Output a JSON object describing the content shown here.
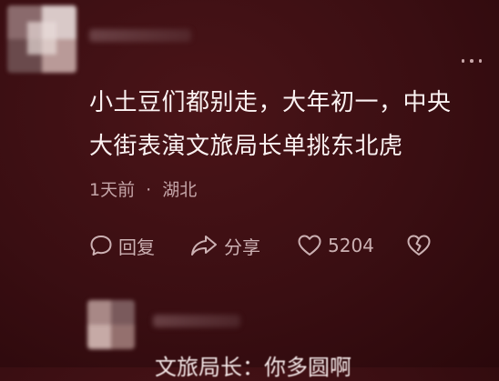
{
  "comment": {
    "line1": "小土豆们都别走，大年初一，中央",
    "line2": "大街表演文旅局长单挑东北虎",
    "time": "1天前",
    "separator": "·",
    "location": "湖北",
    "actions": {
      "reply_label": "回复",
      "share_label": "分享",
      "like_count": "5204"
    }
  },
  "next_comment": {
    "partial_text": "文旅局长：你多圆啊"
  },
  "icons": {
    "more": "more-dots-icon",
    "reply": "speech-bubble-icon",
    "share": "share-arrow-icon",
    "like": "heart-icon",
    "dislike": "broken-heart-icon"
  },
  "colors": {
    "background": "#3a0e12",
    "text": "#fbf2f2",
    "muted": "#c4a5a8"
  }
}
